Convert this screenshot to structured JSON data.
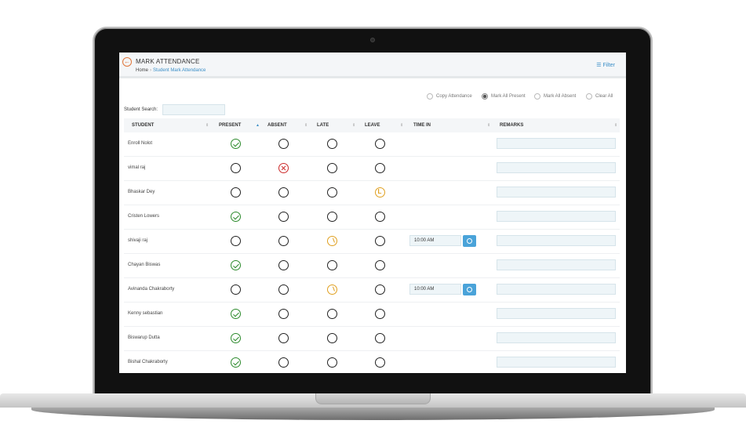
{
  "header": {
    "back_icon": "back-arrow-icon",
    "title": "MARK ATTENDANCE",
    "breadcrumb": {
      "home": "Home",
      "current": "Student Mark Attendance"
    },
    "filter_label": "Filter",
    "filter_icon": "filter-list-icon"
  },
  "toolbar": {
    "options": [
      {
        "label": "Copy Attendance",
        "selected": false
      },
      {
        "label": "Mark All Present",
        "selected": true
      },
      {
        "label": "Mark All Absent",
        "selected": false
      },
      {
        "label": "Clear All",
        "selected": false
      }
    ]
  },
  "search": {
    "label": "Student Search:",
    "value": ""
  },
  "table": {
    "columns": [
      "STUDENT",
      "PRESENT",
      "ABSENT",
      "LATE",
      "LEAVE",
      "TIME IN",
      "REMARKS"
    ],
    "rows": [
      {
        "name": "Enroll Nolot",
        "status": "present",
        "time_in": ""
      },
      {
        "name": "vimal raj",
        "status": "absent",
        "time_in": ""
      },
      {
        "name": "Bhaskar Dey",
        "status": "leave",
        "time_in": ""
      },
      {
        "name": "Cristen Lowers",
        "status": "present",
        "time_in": ""
      },
      {
        "name": "shivaji raj",
        "status": "late",
        "time_in": "10:00 AM"
      },
      {
        "name": "Chayan Biswas",
        "status": "present",
        "time_in": ""
      },
      {
        "name": "Avinanda Chakraborty",
        "status": "late",
        "time_in": "10:00 AM"
      },
      {
        "name": "Kenny sebastian",
        "status": "present",
        "time_in": ""
      },
      {
        "name": "Biswarup Dutta",
        "status": "present",
        "time_in": ""
      },
      {
        "name": "Bishal Chakraborty",
        "status": "present",
        "time_in": ""
      }
    ]
  },
  "colors": {
    "accent": "#3a8ec7",
    "present": "#2c8a2c",
    "absent": "#cc2a2a",
    "late": "#e0a020",
    "back_button": "#e0753a"
  }
}
